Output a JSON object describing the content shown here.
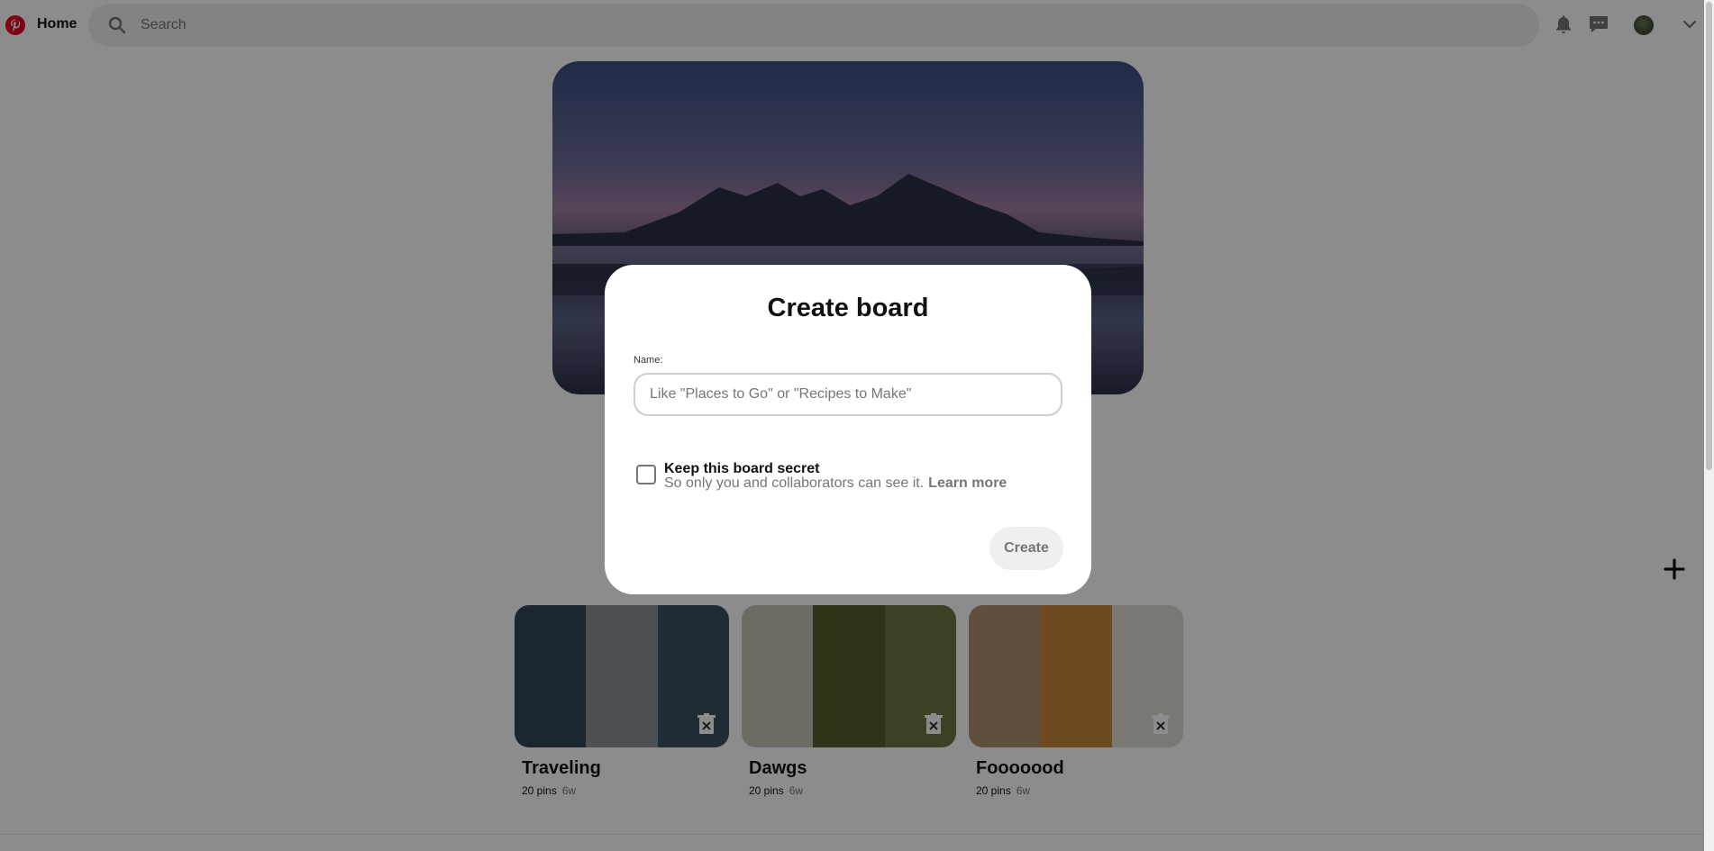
{
  "header": {
    "home_label": "Home",
    "search_placeholder": "Search"
  },
  "icons": {
    "logo": "pinterest-logo",
    "search": "search-icon",
    "notifications": "bell-icon",
    "messages": "chat-bubble-icon",
    "account": "chevron-down-icon",
    "add": "plus-icon",
    "delete_board": "trash-icon"
  },
  "boards": [
    {
      "name": "Traveling",
      "pins": "20 pins",
      "age": "6w",
      "colors": [
        "#34465a",
        "#8c939b",
        "#39515f"
      ]
    },
    {
      "name": "Dawgs",
      "pins": "20 pins",
      "age": "6w",
      "colors": [
        "#c9c4b6",
        "#57602f",
        "#6b7744"
      ]
    },
    {
      "name": "Fooooood",
      "pins": "20 pins",
      "age": "6w",
      "colors": [
        "#b1916f",
        "#c7883b",
        "#dcdad2"
      ]
    }
  ],
  "modal": {
    "title": "Create board",
    "name_label": "Name:",
    "name_placeholder": "Like \"Places to Go\" or \"Recipes to Make\"",
    "name_value": "",
    "secret_title": "Keep this board secret",
    "secret_desc": "So only you and collaborators can see it.",
    "learn_more": "Learn more",
    "secret_checked": false,
    "create_label": "Create"
  },
  "colors": {
    "brand": "#e60023",
    "search_bg": "#efefef",
    "overlay": "rgba(0,0,0,0.45)"
  }
}
